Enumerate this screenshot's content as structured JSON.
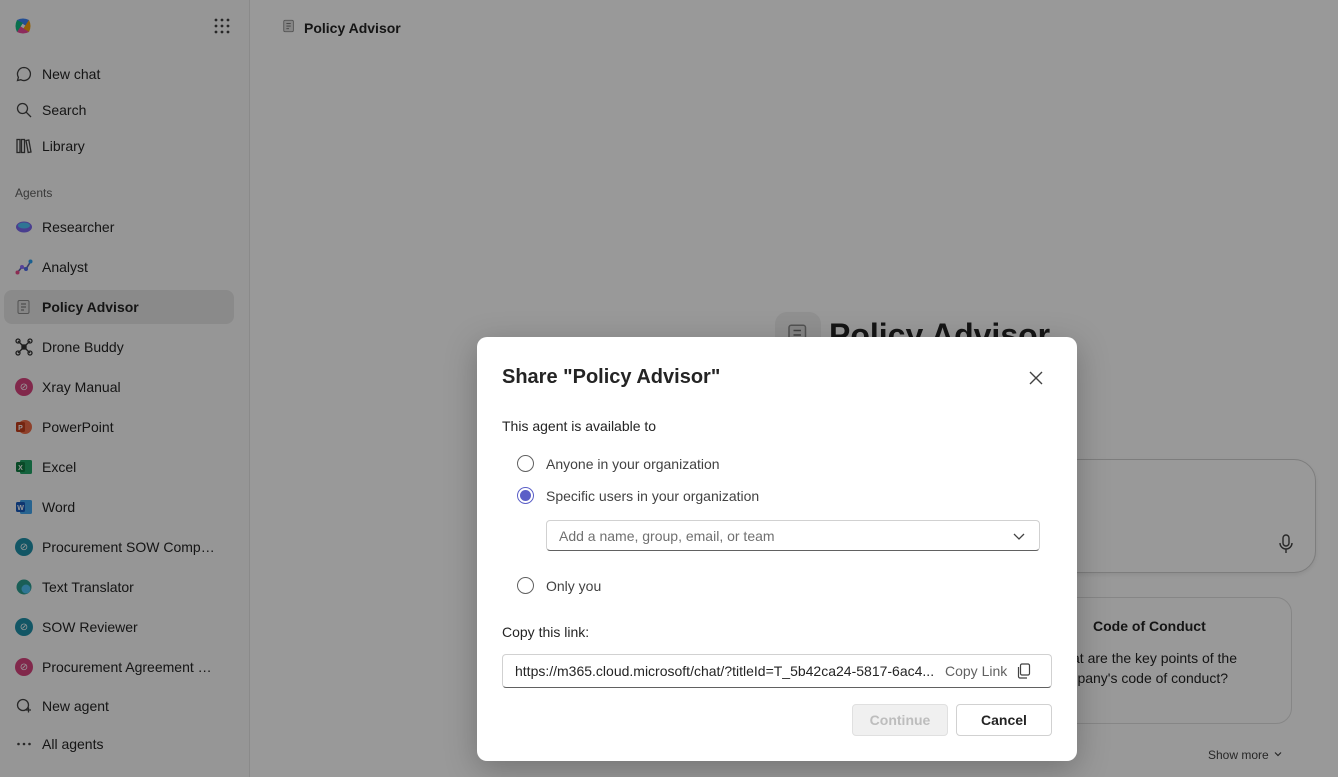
{
  "sidebar": {
    "nav": [
      {
        "label": "New chat",
        "icon": "chat-icon"
      },
      {
        "label": "Search",
        "icon": "search-icon"
      },
      {
        "label": "Library",
        "icon": "library-icon"
      }
    ],
    "agents_section_label": "Agents",
    "agents": [
      {
        "label": "Researcher",
        "icon": "researcher-icon",
        "color": "#7b68ee"
      },
      {
        "label": "Analyst",
        "icon": "analyst-icon",
        "color": "#6264a7"
      },
      {
        "label": "Policy Advisor",
        "icon": "policy-advisor-icon",
        "color": "#9e9e9e",
        "active": true
      },
      {
        "label": "Drone Buddy",
        "icon": "drone-icon",
        "color": "#424242"
      },
      {
        "label": "Xray Manual",
        "icon": "agent-icon",
        "color": "#d8437e"
      },
      {
        "label": "PowerPoint",
        "icon": "powerpoint-icon",
        "color": "#d35230"
      },
      {
        "label": "Excel",
        "icon": "excel-icon",
        "color": "#107c41"
      },
      {
        "label": "Word",
        "icon": "word-icon",
        "color": "#185abd"
      },
      {
        "label": "Procurement SOW Compliance",
        "icon": "agent-icon",
        "color": "#1e8fa8"
      },
      {
        "label": "Text Translator",
        "icon": "translator-icon",
        "color": "#2a9d8f"
      },
      {
        "label": "SOW Reviewer",
        "icon": "agent-icon",
        "color": "#1e8fa8"
      },
      {
        "label": "Procurement Agreement Reviewer",
        "icon": "agent-icon",
        "color": "#d8437e"
      }
    ],
    "new_agent_label": "New agent",
    "all_agents_label": "All agents"
  },
  "header": {
    "title": "Policy Advisor"
  },
  "main": {
    "heading": "Policy Advisor",
    "card": {
      "title": "Code of Conduct",
      "body": "What are the key points of the company's code of conduct?"
    },
    "show_more": "Show more"
  },
  "dialog": {
    "title": "Share \"Policy Advisor\"",
    "availability_label": "This agent is available to",
    "options": [
      {
        "label": "Anyone in your organization",
        "checked": false
      },
      {
        "label": "Specific users in your organization",
        "checked": true
      },
      {
        "label": "Only you",
        "checked": false
      }
    ],
    "people_placeholder": "Add a name, group, email, or team",
    "copy_link_label": "Copy this link:",
    "link_url": "https://m365.cloud.microsoft/chat/?titleId=T_5b42ca24-5817-6ac4...",
    "copy_link_button": "Copy Link",
    "continue_button": "Continue",
    "cancel_button": "Cancel"
  },
  "colors": {
    "accent": "#5b5fc7",
    "sidebar_bg": "#fafafa",
    "active_bg": "#e6e6e6"
  }
}
